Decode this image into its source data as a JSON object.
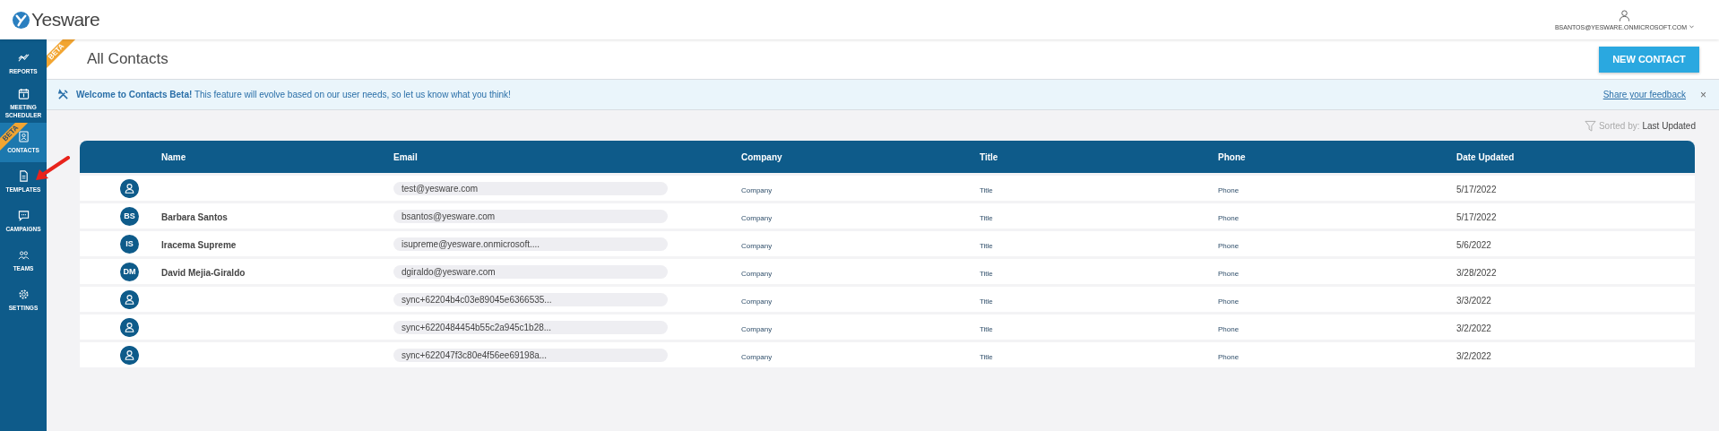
{
  "header": {
    "logo": "Yesware",
    "account": "BSANTOS@YESWARE.ONMICROSOFT.COM"
  },
  "sidebar": {
    "items": [
      {
        "label": "REPORTS",
        "selected": false
      },
      {
        "label": "MEETING SCHEDULER",
        "selected": false
      },
      {
        "label": "CONTACTS",
        "selected": true,
        "badge": "BETA"
      },
      {
        "label": "TEMPLATES",
        "selected": false
      },
      {
        "label": "CAMPAIGNS",
        "selected": false
      },
      {
        "label": "TEAMS",
        "selected": false
      },
      {
        "label": "SETTINGS",
        "selected": false
      }
    ]
  },
  "page": {
    "title": "All Contacts",
    "badge": "BETA",
    "new_button": "NEW CONTACT"
  },
  "banner": {
    "bold": "Welcome to Contacts Beta!",
    "text": "This feature will evolve based on our user needs, so let us know what you think!",
    "link": "Share your feedback",
    "close": "×"
  },
  "sort": {
    "label": "Sorted by:",
    "value": "Last Updated"
  },
  "table": {
    "columns": [
      "Name",
      "Email",
      "Company",
      "Title",
      "Phone",
      "Date Updated"
    ],
    "rows": [
      {
        "avatar": "",
        "name": "",
        "email": "test@yesware.com",
        "company": "Company",
        "title": "Title",
        "phone": "Phone",
        "date": "5/17/2022"
      },
      {
        "avatar": "BS",
        "name": "Barbara Santos",
        "email": "bsantos@yesware.com",
        "company": "Company",
        "title": "Title",
        "phone": "Phone",
        "date": "5/17/2022"
      },
      {
        "avatar": "IS",
        "name": "Iracema Supreme",
        "email": "isupreme@yesware.onmicrosoft....",
        "company": "Company",
        "title": "Title",
        "phone": "Phone",
        "date": "5/6/2022"
      },
      {
        "avatar": "DM",
        "name": "David Mejia-Giraldo",
        "email": "dgiraldo@yesware.com",
        "company": "Company",
        "title": "Title",
        "phone": "Phone",
        "date": "3/28/2022"
      },
      {
        "avatar": "",
        "name": "",
        "email": "sync+62204b4c03e89045e6366535...",
        "company": "Company",
        "title": "Title",
        "phone": "Phone",
        "date": "3/3/2022"
      },
      {
        "avatar": "",
        "name": "",
        "email": "sync+6220484454b55c2a945c1b28...",
        "company": "Company",
        "title": "Title",
        "phone": "Phone",
        "date": "3/2/2022"
      },
      {
        "avatar": "",
        "name": "",
        "email": "sync+622047f3c80e4f56ee69198a...",
        "company": "Company",
        "title": "Title",
        "phone": "Phone",
        "date": "3/2/2022"
      }
    ]
  }
}
